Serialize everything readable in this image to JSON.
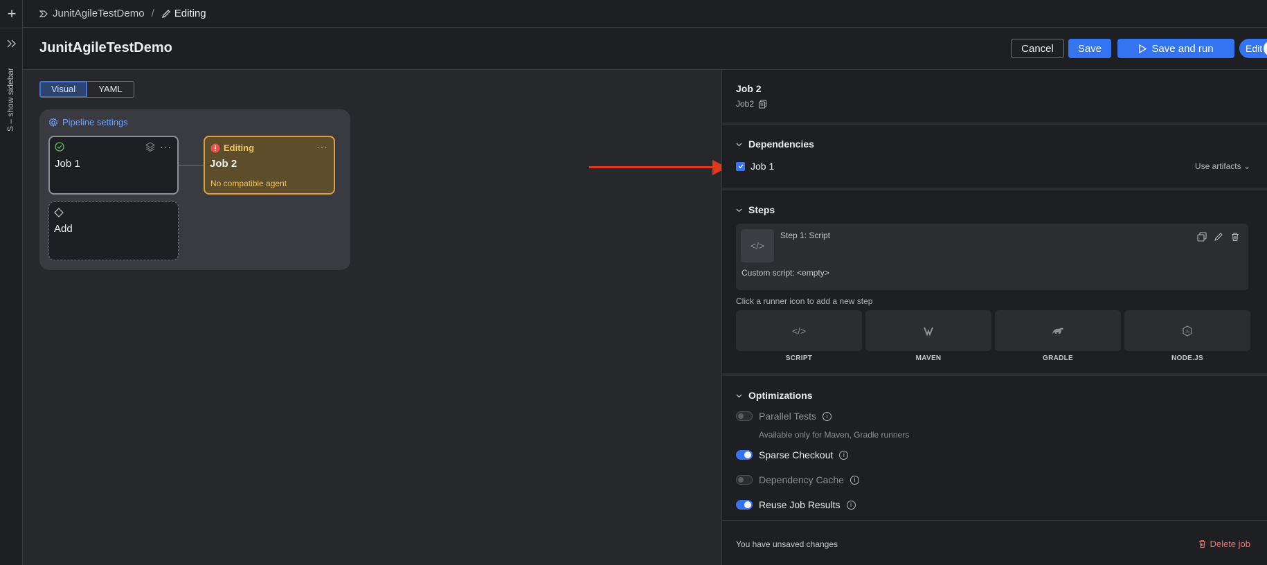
{
  "sidebar": {
    "toggle_label": "S – show sidebar"
  },
  "breadcrumb": {
    "project": "JunitAgileTestDemo",
    "separator": "/",
    "current": "Editing"
  },
  "header": {
    "title": "JunitAgileTestDemo",
    "cancel_label": "Cancel",
    "save_label": "Save",
    "save_run_label": "Save and run",
    "edit_label": "Edit"
  },
  "canvas": {
    "tabs": [
      {
        "label": "Visual",
        "active": true
      },
      {
        "label": "YAML",
        "active": false
      }
    ],
    "pipeline_settings_label": "Pipeline settings",
    "jobs": [
      {
        "name": "Job 1",
        "status": "ok"
      },
      {
        "name": "Job 2",
        "status_label": "Editing",
        "sub": "No compatible agent"
      }
    ],
    "add_label": "Add"
  },
  "panel": {
    "job_name": "Job 2",
    "job_id": "Job2",
    "dependencies": {
      "title": "Dependencies",
      "items": [
        {
          "label": "Job 1",
          "checked": true
        }
      ],
      "artifacts_label": "Use artifacts"
    },
    "steps": {
      "title": "Steps",
      "items": [
        {
          "title": "Step 1: Script",
          "desc": "Custom script: <empty>"
        }
      ],
      "hint": "Click a runner icon to add a new step",
      "runners": [
        {
          "label": "SCRIPT",
          "icon": "code-icon"
        },
        {
          "label": "MAVEN",
          "icon": "maven-icon"
        },
        {
          "label": "GRADLE",
          "icon": "gradle-icon"
        },
        {
          "label": "NODE.JS",
          "icon": "nodejs-icon"
        }
      ]
    },
    "optimizations": {
      "title": "Optimizations",
      "items": [
        {
          "label": "Parallel Tests",
          "enabled": false,
          "sub": "Available only for Maven, Gradle runners"
        },
        {
          "label": "Sparse Checkout",
          "enabled": true
        },
        {
          "label": "Dependency Cache",
          "enabled": false
        },
        {
          "label": "Reuse Job Results",
          "enabled": true
        }
      ]
    },
    "footer": {
      "unsaved": "You have unsaved changes",
      "delete_label": "Delete job"
    }
  },
  "colors": {
    "accent": "#3574f0",
    "warning": "#d9a343",
    "danger": "#e2371f"
  }
}
